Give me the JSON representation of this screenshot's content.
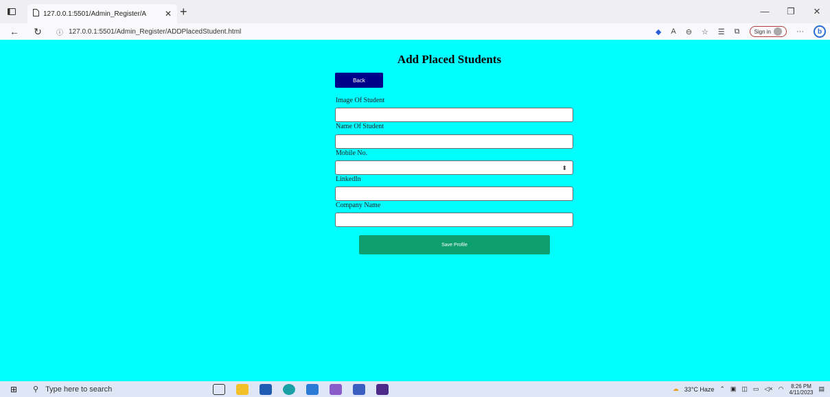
{
  "browser": {
    "tab_title": "127.0.0.1:5501/Admin_Register/ADDPlacedStudent.html",
    "tab_title_short": "127.0.0.1:5501/Admin_Register/A",
    "url": "127.0.0.1:5501/Admin_Register/ADDPlacedStudent.html",
    "signin_label": "Sign in",
    "more_label": "···",
    "bing_label": "b"
  },
  "page": {
    "title": "Add Placed Students",
    "back_label": "Back",
    "fields": [
      {
        "label": "Image Of Student",
        "value": ""
      },
      {
        "label": "Name Of Student",
        "value": ""
      },
      {
        "label": "Mobile No.",
        "value": ""
      },
      {
        "label": "LinkedIn",
        "value": ""
      },
      {
        "label": "Company Name",
        "value": ""
      }
    ],
    "save_label": "Save Profile"
  },
  "taskbar": {
    "search_placeholder": "Type here to search",
    "weather": "33°C Haze",
    "time": "8:26 PM",
    "date": "4/11/2023"
  },
  "colors": {
    "page_bg": "#00ffff",
    "back_button": "#00008b",
    "save_button": "#0e9f6e"
  }
}
